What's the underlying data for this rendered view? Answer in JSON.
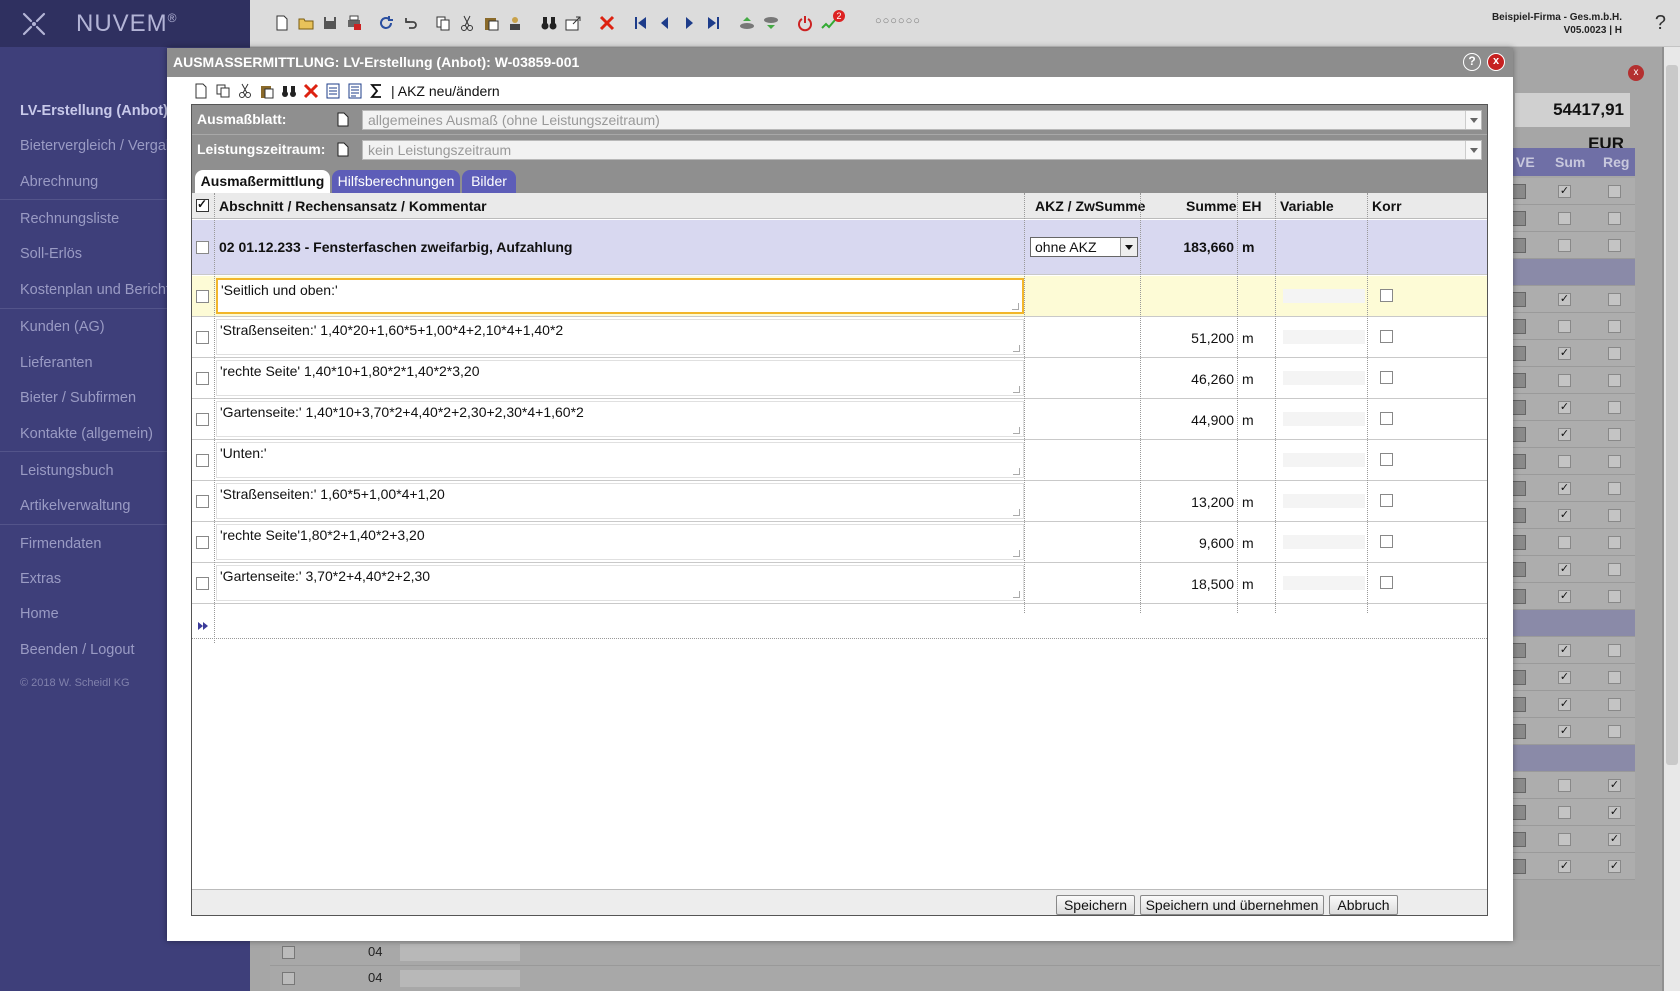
{
  "app": {
    "brand": "NUVEM",
    "brand_mark": "®"
  },
  "company": {
    "name": "Beispiel-Firma - Ges.m.b.H.",
    "version": "V05.0023 | H"
  },
  "topbar": {
    "help_label": "?",
    "notification_count": "2",
    "dots": "○○○○○○"
  },
  "sidebar": {
    "items": [
      {
        "label": "LV-Erstellung (Anbot)",
        "active": true
      },
      {
        "label": "Bietervergleich / Vergabe"
      },
      {
        "label": "Abrechnung"
      },
      {
        "label": "Rechnungsliste"
      },
      {
        "label": "Soll-Erlös"
      },
      {
        "label": "Kostenplan und Bericht"
      },
      {
        "label": "Kunden (AG)"
      },
      {
        "label": "Lieferanten"
      },
      {
        "label": "Bieter / Subfirmen"
      },
      {
        "label": "Kontakte (allgemein)"
      },
      {
        "label": "Leistungsbuch"
      },
      {
        "label": "Artikelverwaltung"
      },
      {
        "label": "Firmendaten"
      },
      {
        "label": "Extras"
      },
      {
        "label": "Home"
      },
      {
        "label": "Beenden / Logout"
      }
    ],
    "copyright": "© 2018 W. Scheidl KG"
  },
  "background": {
    "total": "54417,91 EUR",
    "col_sum": "Sum",
    "col_reg": "Reg",
    "col_ve": "VE",
    "rows_bottom": [
      "04",
      "04"
    ]
  },
  "modal": {
    "title": "AUSMASSERMITTLUNG: LV-Erstellung (Anbot): W-03859-001",
    "help_label": "?",
    "close_label": "x",
    "toolbar_text": "| AKZ neu/ändern",
    "ausmassblatt_label": "Ausmaßblatt:",
    "ausmassblatt_value": "allgemeines Ausmaß (ohne Leistungszeitraum)",
    "leistungszeitraum_label": "Leistungszeitraum:",
    "leistungszeitraum_value": "kein Leistungszeitraum",
    "tabs": [
      {
        "label": "Ausmaßermittlung",
        "active": true
      },
      {
        "label": "Hilfsberechnungen"
      },
      {
        "label": "Bilder"
      }
    ],
    "columns": {
      "abschnitt": "Abschnitt / Rechensansatz / Kommentar",
      "akz": "AKZ / ZwSumme",
      "summe": "Summe",
      "eh": "EH",
      "variable": "Variable",
      "korr": "Korr"
    },
    "position": {
      "title": "02 01.12.233 - Fensterfaschen zweifarbig, Aufzahlung",
      "akz": "ohne AKZ",
      "summe": "183,660",
      "eh": "m"
    },
    "rows": [
      {
        "text": "'Seitlich und oben:'",
        "summe": "",
        "eh": ""
      },
      {
        "text": "'Straßenseiten:' 1,40*20+1,60*5+1,00*4+2,10*4+1,40*2",
        "summe": "51,200",
        "eh": "m"
      },
      {
        "text": "'rechte Seite' 1,40*10+1,80*2*1,40*2*3,20",
        "summe": "46,260",
        "eh": "m"
      },
      {
        "text": "'Gartenseite:' 1,40*10+3,70*2+4,40*2+2,30+2,30*4+1,60*2",
        "summe": "44,900",
        "eh": "m"
      },
      {
        "text": "'Unten:'",
        "summe": "",
        "eh": ""
      },
      {
        "text": "'Straßenseiten:' 1,60*5+1,00*4+1,20",
        "summe": "13,200",
        "eh": "m"
      },
      {
        "text": "'rechte Seite'1,80*2+1,40*2+3,20",
        "summe": "9,600",
        "eh": "m"
      },
      {
        "text": "'Gartenseite:' 3,70*2+4,40*2+2,30",
        "summe": "18,500",
        "eh": "m"
      }
    ],
    "buttons": {
      "save": "Speichern",
      "save_apply": "Speichern und übernehmen",
      "cancel": "Abbruch"
    }
  }
}
